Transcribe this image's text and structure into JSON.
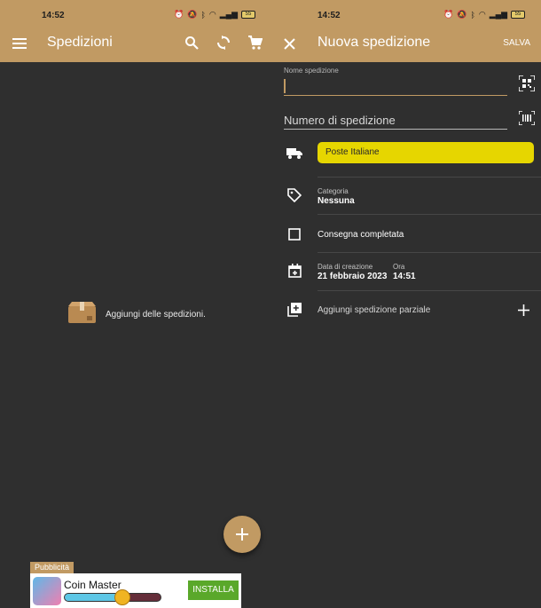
{
  "left_screen": {
    "status_time": "14:52",
    "battery": "55",
    "title": "Spedizioni",
    "empty_text": "Aggiungi delle spedizioni.",
    "ad": {
      "tag": "Pubblicità",
      "app_name": "Coin Master",
      "install_label": "INSTALLA",
      "progress": 0.6
    }
  },
  "right_screen": {
    "status_time": "14:52",
    "battery": "55",
    "title": "Nuova spedizione",
    "save_label": "SALVA",
    "name_caption": "Nome spedizione",
    "name_value": "",
    "tracking_placeholder": "Numero di spedizione",
    "courier": "Poste Italiane",
    "category_label": "Categoria",
    "category_value": "Nessuna",
    "delivered_label": "Consegna completata",
    "date_label": "Data di creazione",
    "date_value": "21 febbraio 2023",
    "time_label": "Ora",
    "time_value": "14:51",
    "partial_label": "Aggiungi spedizione parziale"
  },
  "colors": {
    "accent": "#c19a63",
    "background": "#2f2f2f",
    "courier_chip": "#e6d600",
    "install_button": "#5aa82a"
  }
}
